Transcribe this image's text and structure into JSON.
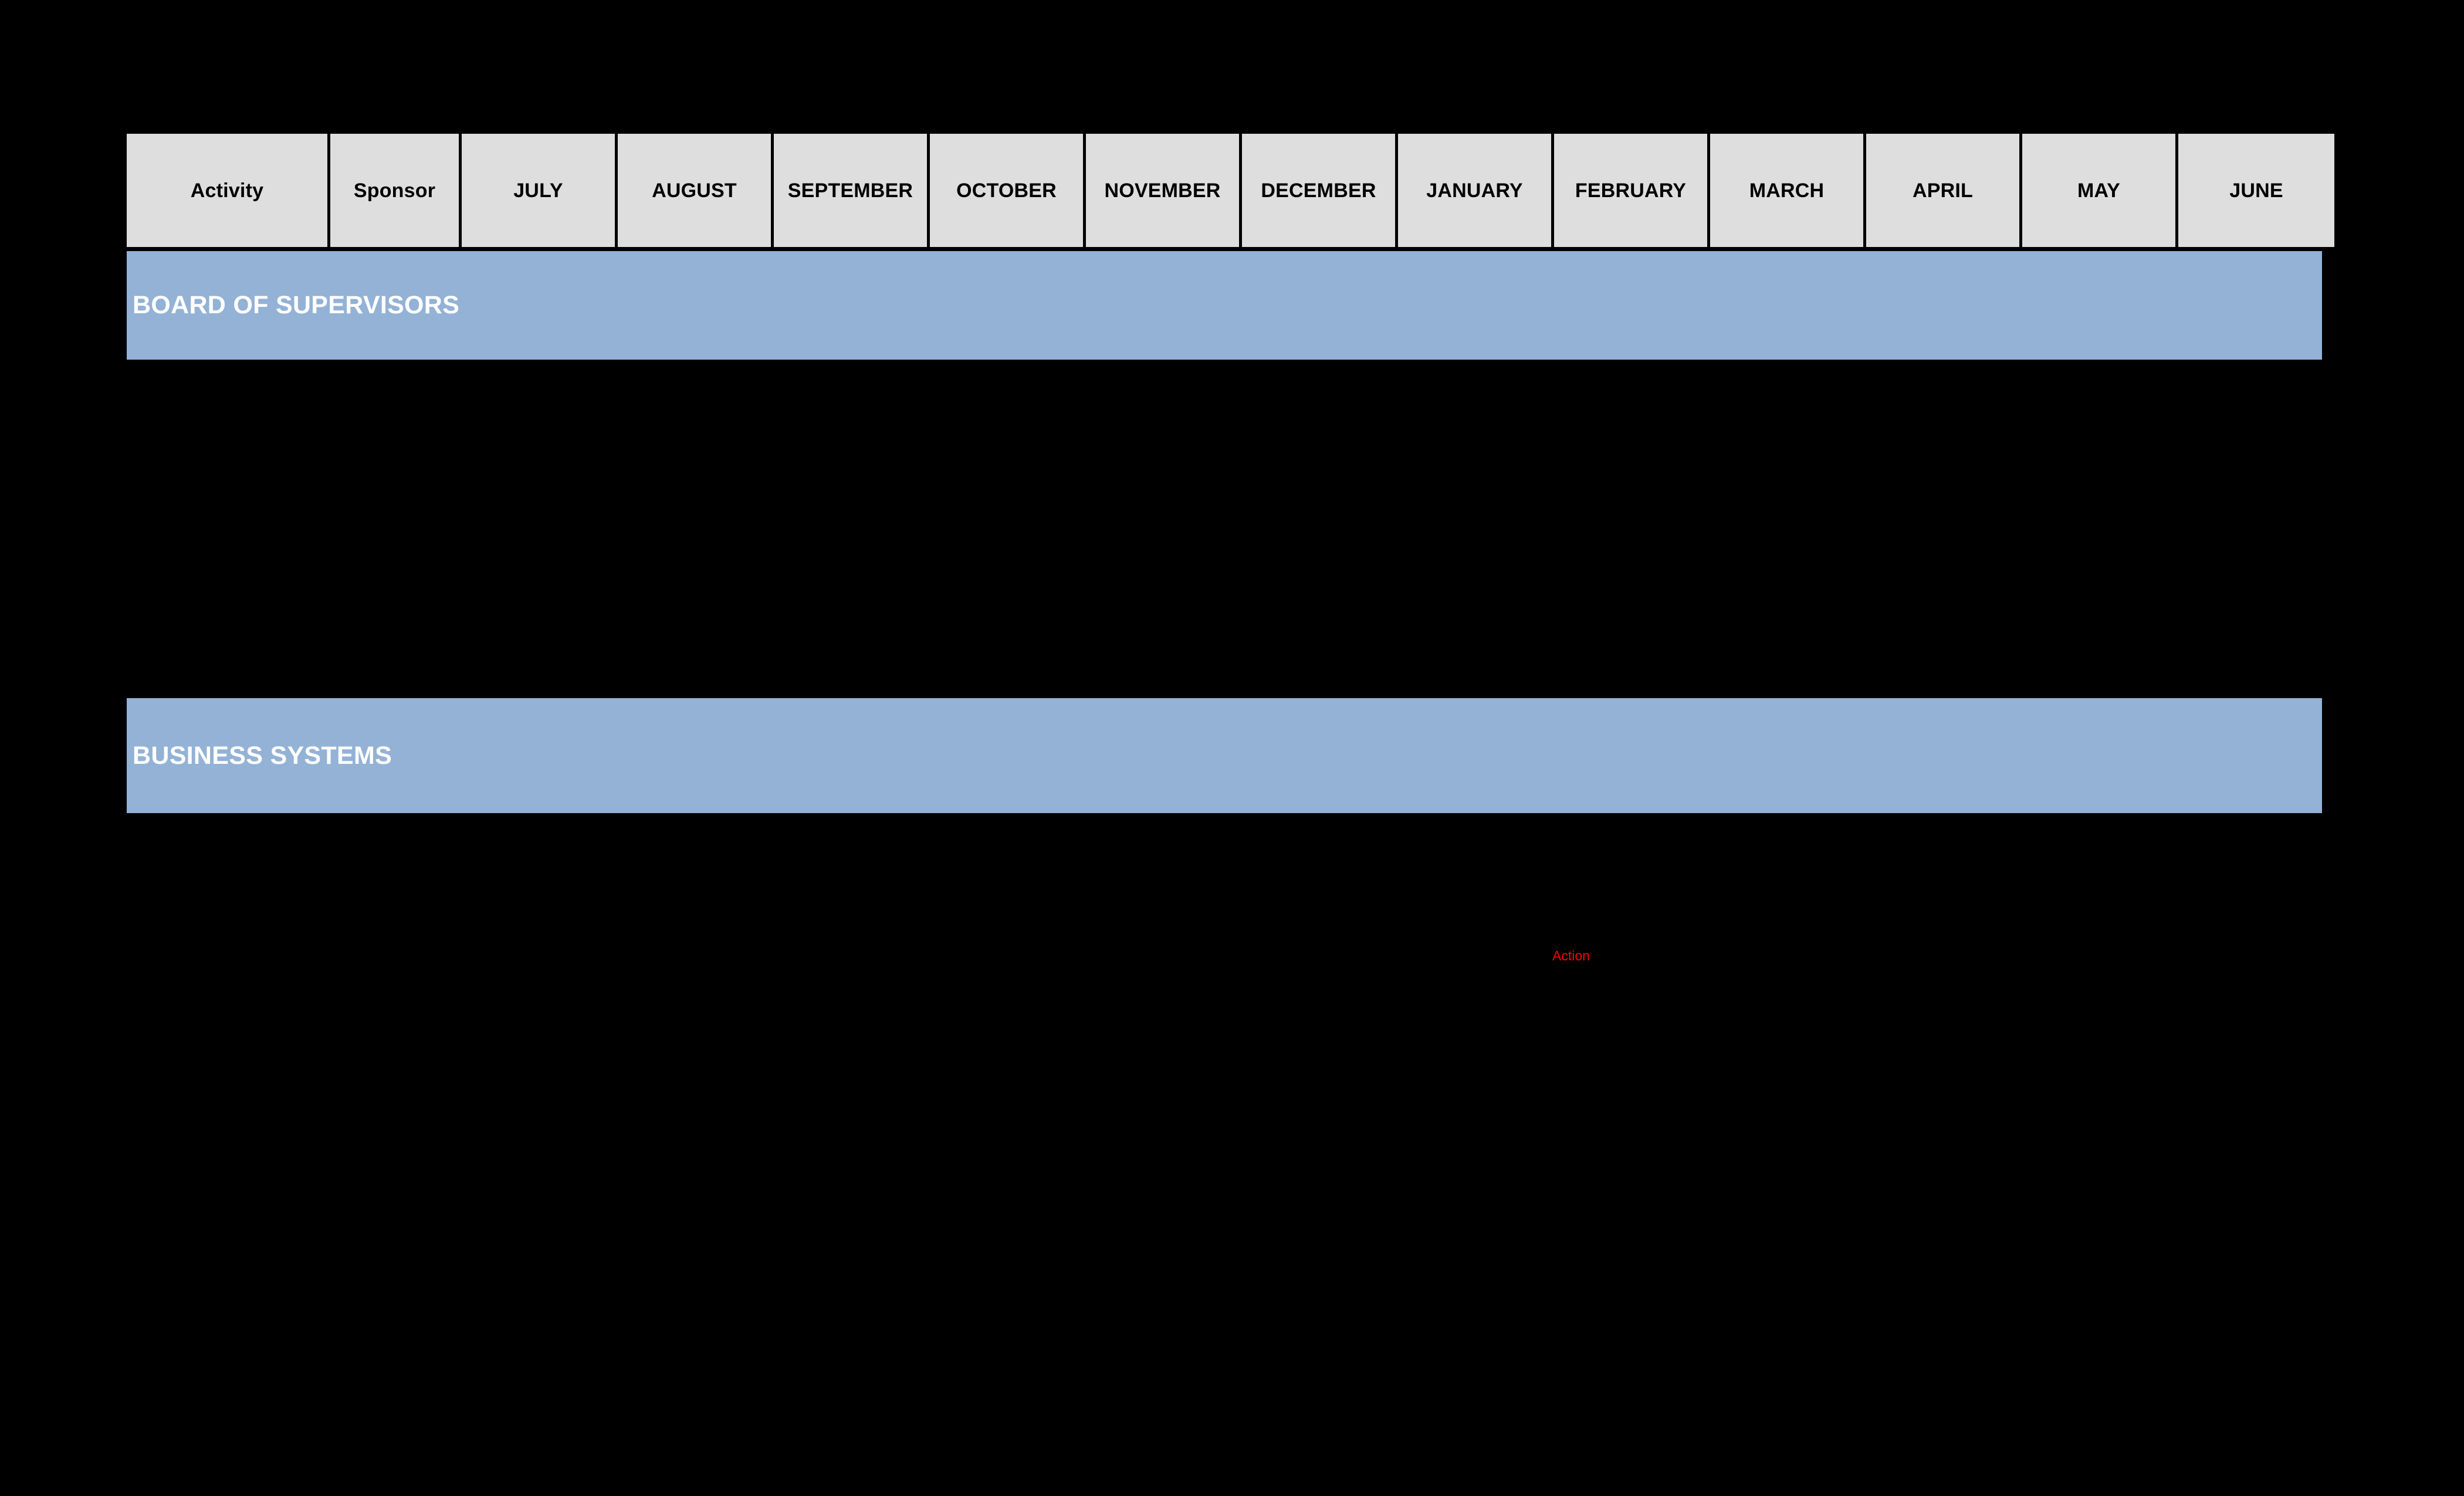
{
  "page": {
    "background_color": "#000000",
    "table_border_color": "#000000"
  },
  "table": {
    "header": {
      "background_color": "#dedede",
      "text_color": "#000000",
      "columns": [
        {
          "label": "Activity",
          "type": "activity"
        },
        {
          "label": "Sponsor",
          "type": "sponsor"
        },
        {
          "label": "JULY",
          "type": "month"
        },
        {
          "label": "AUGUST",
          "type": "month"
        },
        {
          "label": "SEPTEMBER",
          "type": "month"
        },
        {
          "label": "OCTOBER",
          "type": "month"
        },
        {
          "label": "NOVEMBER",
          "type": "month"
        },
        {
          "label": "DECEMBER",
          "type": "month"
        },
        {
          "label": "JANUARY",
          "type": "month"
        },
        {
          "label": "FEBRUARY",
          "type": "month"
        },
        {
          "label": "MARCH",
          "type": "month"
        },
        {
          "label": "APRIL",
          "type": "month"
        },
        {
          "label": "MAY",
          "type": "month"
        },
        {
          "label": "JUNE",
          "type": "month"
        }
      ]
    },
    "sections": [
      {
        "label": "BOARD OF SUPERVISORS",
        "band_color": "#93b2d5",
        "band_text_color": "#ffffff",
        "rows": []
      },
      {
        "label": "BUSINESS SYSTEMS",
        "band_color": "#93b2d5",
        "band_text_color": "#ffffff",
        "rows": []
      }
    ]
  },
  "annotations": [
    {
      "text": "Action",
      "color": "#ff0000"
    }
  ]
}
